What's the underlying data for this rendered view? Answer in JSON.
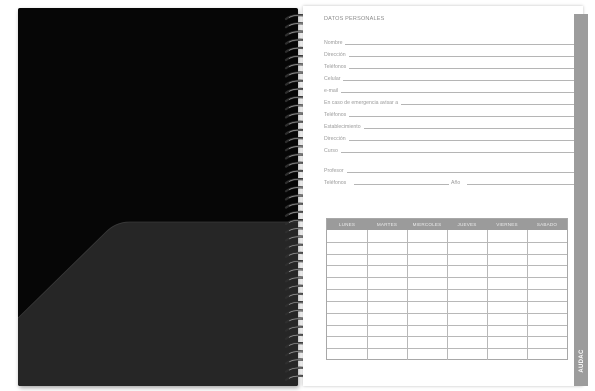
{
  "form": {
    "title": "DATOS PERSONALES",
    "fields": [
      {
        "label": "Nombre"
      },
      {
        "label": "Dirección"
      },
      {
        "label": "Teléfonos"
      },
      {
        "label": "Celular"
      },
      {
        "label": "e-mail"
      },
      {
        "label": "En caso de emergencia avisar a"
      },
      {
        "label": "Teléfonos"
      },
      {
        "label": "Establecimiento"
      },
      {
        "label": "Dirección"
      },
      {
        "label": "Curso"
      },
      {
        "label": "Profesor"
      }
    ],
    "last_row": {
      "label": "Teléfonos",
      "second_label": "Año"
    }
  },
  "timetable": {
    "days": [
      "LUNES",
      "MARTES",
      "MIERCOLES",
      "JUEVES",
      "VIERNES",
      "SABADO"
    ],
    "rows": 11
  },
  "brand": "AUDAC",
  "colors": {
    "cover": "#060606",
    "pocket": "#262626",
    "table_header": "#9b9b9b",
    "side_tab": "#9c9c9c"
  }
}
